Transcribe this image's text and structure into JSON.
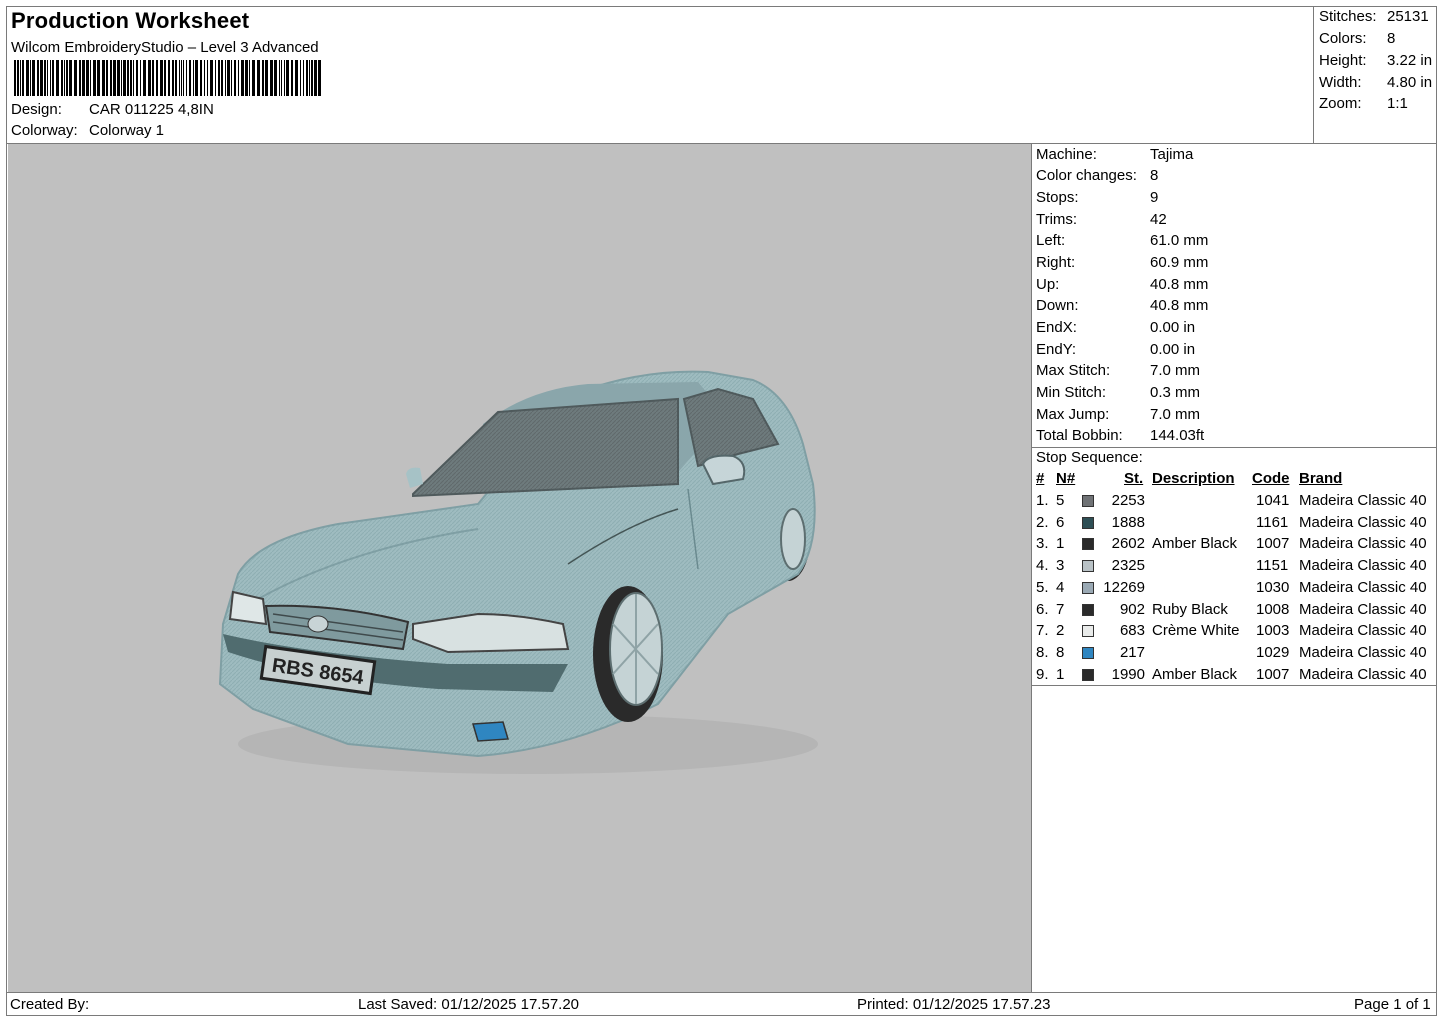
{
  "header": {
    "title": "Production Worksheet",
    "software": "Wilcom EmbroideryStudio – Level 3 Advanced",
    "design_label": "Design:",
    "design_value": "CAR 011225 4,8IN",
    "colorway_label": "Colorway:",
    "colorway_value": "Colorway 1"
  },
  "stats": [
    {
      "label": "Stitches:",
      "value": "25131"
    },
    {
      "label": "Colors:",
      "value": "8"
    },
    {
      "label": "Height:",
      "value": "3.22 in"
    },
    {
      "label": "Width:",
      "value": "4.80 in"
    },
    {
      "label": "Zoom:",
      "value": "1:1"
    }
  ],
  "machine_info": [
    {
      "label": "Machine:",
      "value": "Tajima"
    },
    {
      "label": "Color changes:",
      "value": "8"
    },
    {
      "label": "Stops:",
      "value": "9"
    },
    {
      "label": "Trims:",
      "value": "42"
    },
    {
      "label": "Left:",
      "value": "61.0 mm"
    },
    {
      "label": "Right:",
      "value": "60.9 mm"
    },
    {
      "label": "Up:",
      "value": "40.8 mm"
    },
    {
      "label": "Down:",
      "value": "40.8 mm"
    },
    {
      "label": "EndX:",
      "value": "0.00 in"
    },
    {
      "label": "EndY:",
      "value": "0.00 in"
    },
    {
      "label": "Max Stitch:",
      "value": "7.0 mm"
    },
    {
      "label": "Min Stitch:",
      "value": "0.3 mm"
    },
    {
      "label": "Max Jump:",
      "value": "7.0 mm"
    },
    {
      "label": "Total Bobbin:",
      "value": "144.03ft"
    }
  ],
  "stop_sequence": {
    "title": "Stop Sequence:",
    "columns": {
      "num": "#",
      "n": "N#",
      "st": "St.",
      "description": "Description",
      "code": "Code",
      "brand": "Brand"
    },
    "rows": [
      {
        "num": "1.",
        "n": "5",
        "color": "#6f7275",
        "st": "2253",
        "description": "",
        "code": "1041",
        "brand": "Madeira Classic 40"
      },
      {
        "num": "2.",
        "n": "6",
        "color": "#2e4f55",
        "st": "1888",
        "description": "",
        "code": "1161",
        "brand": "Madeira Classic 40"
      },
      {
        "num": "3.",
        "n": "1",
        "color": "#2a2a2a",
        "st": "2602",
        "description": "Amber Black",
        "code": "1007",
        "brand": "Madeira Classic 40"
      },
      {
        "num": "4.",
        "n": "3",
        "color": "#b9c2c6",
        "st": "2325",
        "description": "",
        "code": "1151",
        "brand": "Madeira Classic 40"
      },
      {
        "num": "5.",
        "n": "4",
        "color": "#9aa9b4",
        "st": "12269",
        "description": "",
        "code": "1030",
        "brand": "Madeira Classic 40"
      },
      {
        "num": "6.",
        "n": "7",
        "color": "#2b2b2b",
        "st": "902",
        "description": "Ruby Black",
        "code": "1008",
        "brand": "Madeira Classic 40"
      },
      {
        "num": "7.",
        "n": "2",
        "color": "#e9ebea",
        "st": "683",
        "description": "Crème White",
        "code": "1003",
        "brand": "Madeira Classic 40"
      },
      {
        "num": "8.",
        "n": "8",
        "color": "#2f86c1",
        "st": "217",
        "description": "",
        "code": "1029",
        "brand": "Madeira Classic 40"
      },
      {
        "num": "9.",
        "n": "1",
        "color": "#2a2a2a",
        "st": "1990",
        "description": "Amber Black",
        "code": "1007",
        "brand": "Madeira Classic 40"
      }
    ]
  },
  "plate_text": "RBS 8654",
  "footer": {
    "created_by": "Created By:",
    "last_saved": "Last Saved: 01/12/2025 17.57.20",
    "printed": "Printed: 01/12/2025 17.57.23",
    "page": "Page 1 of 1"
  },
  "colors": {
    "canvas_bg": "#c0c0c0",
    "car_body": "#9fbcc0",
    "border": "#7a7a7a"
  }
}
